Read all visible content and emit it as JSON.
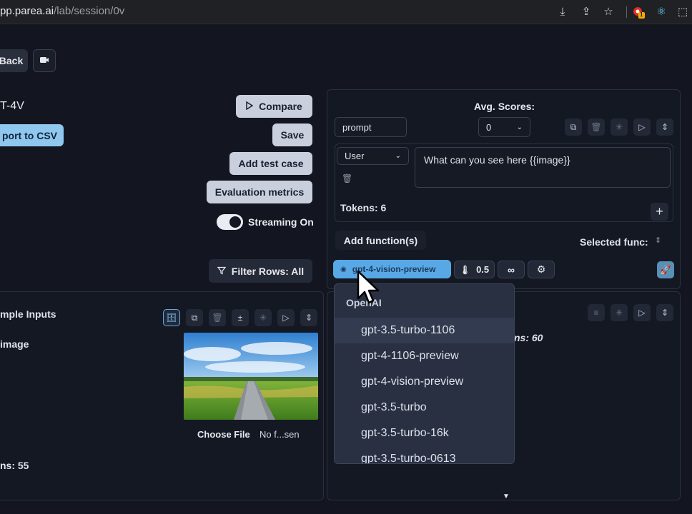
{
  "browser": {
    "url_host": "pp.parea.ai",
    "url_path": "/lab/session/0v",
    "ext_badge": "1"
  },
  "left": {
    "back_label": "Back",
    "title_fragment": "T-4V",
    "export_label": "port to CSV",
    "compare_label": "Compare",
    "save_label": "Save",
    "add_test_case_label": "Add test case",
    "evaluation_metrics_label": "Evaluation metrics",
    "streaming_label": "Streaming On",
    "filter_label": "Filter Rows: All",
    "sample_inputs_label": "mple Inputs",
    "image_var_label": "image",
    "choose_file_label": "Choose File",
    "no_file_label": "No f...sen",
    "tokens_label": "ns: 55"
  },
  "right": {
    "avg_scores_label": "Avg. Scores:",
    "prompt_name_value": "prompt",
    "score_select_value": "0",
    "role_value": "User",
    "message_value": "What can you see here {{image}}",
    "tokens_label": "Tokens: 6",
    "add_functions_label": "Add function(s)",
    "selected_func_label": "Selected func:",
    "model_chip_label": "gpt-4-vision-preview",
    "temperature_value": "0.5",
    "infinity_label": "∞",
    "lower_tokens_label": "ns: 60"
  },
  "dropdown": {
    "group_label": "OpenAI",
    "options": [
      "gpt-3.5-turbo-1106",
      "gpt-4-1106-preview",
      "gpt-4-vision-preview",
      "gpt-3.5-turbo",
      "gpt-3.5-turbo-16k",
      "gpt-3.5-turbo-0613"
    ],
    "highlighted_index": 0
  },
  "colors": {
    "background": "#131620",
    "accent_blue": "#8fc7ef",
    "light_button": "#c9cfdd",
    "dropdown_bg": "#283042"
  }
}
